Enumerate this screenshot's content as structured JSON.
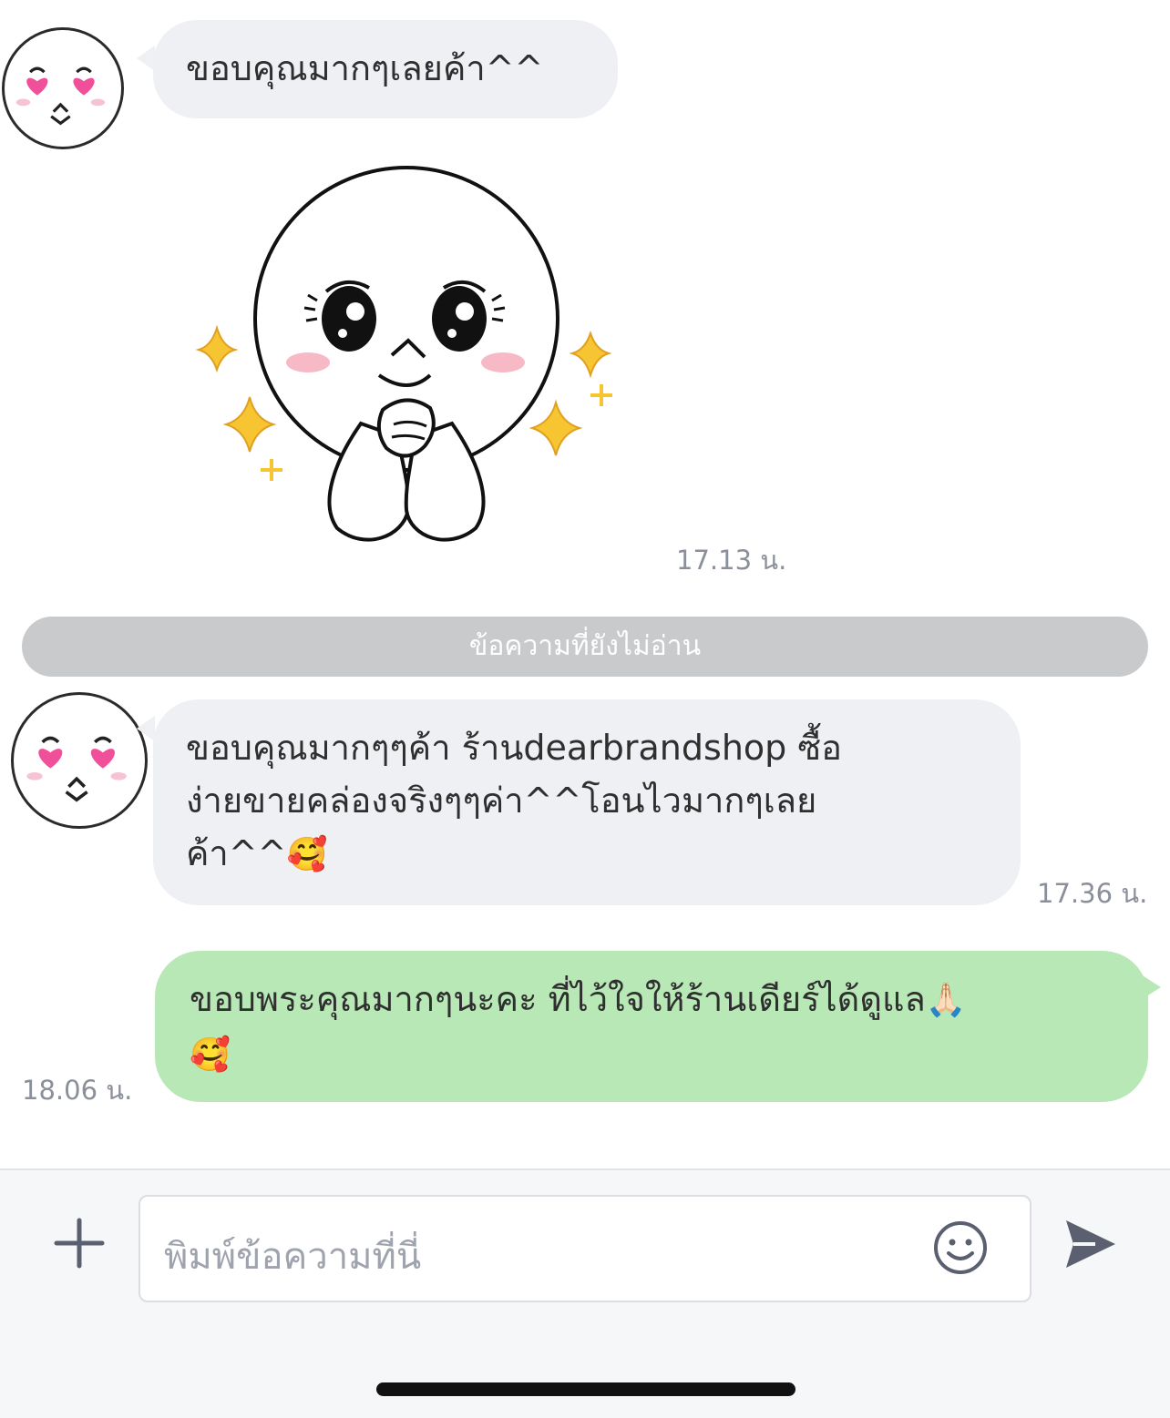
{
  "messages": [
    {
      "direction": "incoming",
      "type": "text",
      "text": "ขอบคุณมากๆเลยค้า^^"
    },
    {
      "direction": "incoming",
      "type": "sticker",
      "sticker": "praying-moon-sticker",
      "time": "17.13 น."
    },
    {
      "direction": "incoming",
      "type": "text",
      "lines": [
        "ขอบคุณมากๆๆค้า ร้านdearbrandshop ซื้อ",
        "ง่ายขายคล่องจริงๆๆค่า^^โอนไวมากๆเลย",
        "ค้า^^"
      ],
      "emoji": "🥰",
      "time": "17.36 น."
    },
    {
      "direction": "outgoing",
      "type": "text",
      "lines": [
        "ขอบพระคุณมากๆนะคะ ที่ไว้ใจให้ร้านเดียร์ได้ดูแล"
      ],
      "emoji_inline": "🙏🏻",
      "emoji_line2": "🥰",
      "time": "18.06 น."
    }
  ],
  "unread_divider": "ข้อความที่ยังไม่อ่าน",
  "composer": {
    "placeholder": "พิมพ์ข้อความที่นี่",
    "add_icon": "plus-icon",
    "emoji_icon": "smiley-icon",
    "send_icon": "send-icon"
  },
  "colors": {
    "incoming_bubble": "#eff0f3",
    "outgoing_bubble": "#b9e8b7",
    "divider": "#c9cacc",
    "icon": "#5a6070"
  }
}
